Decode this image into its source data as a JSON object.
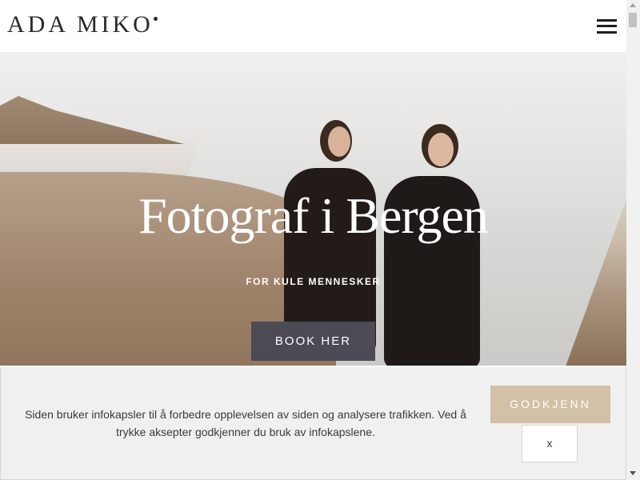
{
  "header": {
    "logo_text": "ADA MIKO",
    "menu_icon": "hamburger-menu-icon"
  },
  "hero": {
    "title": "Fotograf i Bergen",
    "subtitle": "FOR KULE MENNESKER",
    "cta_label": "BOOK HER"
  },
  "cookie_banner": {
    "message": "Siden bruker infokapsler til å forbedre opplevelsen av siden og analysere trafikken. Ved å trykke aksepter godkjenner du bruk av infokapslene.",
    "accept_label": "GODKJENN",
    "close_label": "x"
  },
  "colors": {
    "cta_background": "#4b4a55",
    "accept_background": "#d2c1a6",
    "banner_background": "#f0f0f0"
  }
}
